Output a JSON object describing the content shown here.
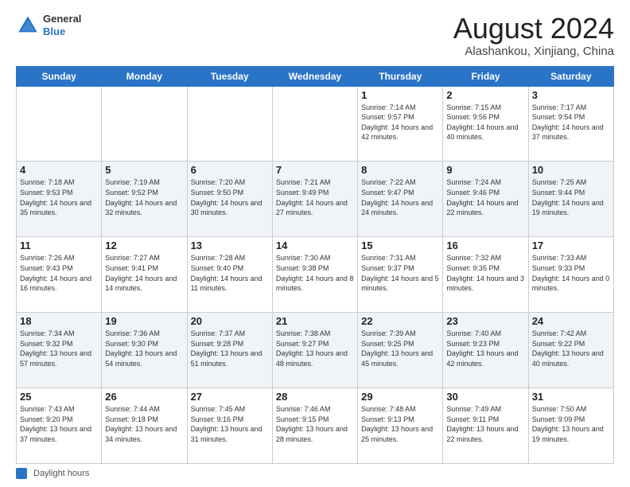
{
  "header": {
    "logo": {
      "general": "General",
      "blue": "Blue"
    },
    "title": "August 2024",
    "location": "Alashankou, Xinjiang, China"
  },
  "weekdays": [
    "Sunday",
    "Monday",
    "Tuesday",
    "Wednesday",
    "Thursday",
    "Friday",
    "Saturday"
  ],
  "weeks": [
    [
      {
        "day": "",
        "info": ""
      },
      {
        "day": "",
        "info": ""
      },
      {
        "day": "",
        "info": ""
      },
      {
        "day": "",
        "info": ""
      },
      {
        "day": "1",
        "info": "Sunrise: 7:14 AM\nSunset: 9:57 PM\nDaylight: 14 hours and 42 minutes."
      },
      {
        "day": "2",
        "info": "Sunrise: 7:15 AM\nSunset: 9:56 PM\nDaylight: 14 hours and 40 minutes."
      },
      {
        "day": "3",
        "info": "Sunrise: 7:17 AM\nSunset: 9:54 PM\nDaylight: 14 hours and 37 minutes."
      }
    ],
    [
      {
        "day": "4",
        "info": "Sunrise: 7:18 AM\nSunset: 9:53 PM\nDaylight: 14 hours and 35 minutes."
      },
      {
        "day": "5",
        "info": "Sunrise: 7:19 AM\nSunset: 9:52 PM\nDaylight: 14 hours and 32 minutes."
      },
      {
        "day": "6",
        "info": "Sunrise: 7:20 AM\nSunset: 9:50 PM\nDaylight: 14 hours and 30 minutes."
      },
      {
        "day": "7",
        "info": "Sunrise: 7:21 AM\nSunset: 9:49 PM\nDaylight: 14 hours and 27 minutes."
      },
      {
        "day": "8",
        "info": "Sunrise: 7:22 AM\nSunset: 9:47 PM\nDaylight: 14 hours and 24 minutes."
      },
      {
        "day": "9",
        "info": "Sunrise: 7:24 AM\nSunset: 9:46 PM\nDaylight: 14 hours and 22 minutes."
      },
      {
        "day": "10",
        "info": "Sunrise: 7:25 AM\nSunset: 9:44 PM\nDaylight: 14 hours and 19 minutes."
      }
    ],
    [
      {
        "day": "11",
        "info": "Sunrise: 7:26 AM\nSunset: 9:43 PM\nDaylight: 14 hours and 16 minutes."
      },
      {
        "day": "12",
        "info": "Sunrise: 7:27 AM\nSunset: 9:41 PM\nDaylight: 14 hours and 14 minutes."
      },
      {
        "day": "13",
        "info": "Sunrise: 7:28 AM\nSunset: 9:40 PM\nDaylight: 14 hours and 11 minutes."
      },
      {
        "day": "14",
        "info": "Sunrise: 7:30 AM\nSunset: 9:38 PM\nDaylight: 14 hours and 8 minutes."
      },
      {
        "day": "15",
        "info": "Sunrise: 7:31 AM\nSunset: 9:37 PM\nDaylight: 14 hours and 5 minutes."
      },
      {
        "day": "16",
        "info": "Sunrise: 7:32 AM\nSunset: 9:35 PM\nDaylight: 14 hours and 3 minutes."
      },
      {
        "day": "17",
        "info": "Sunrise: 7:33 AM\nSunset: 9:33 PM\nDaylight: 14 hours and 0 minutes."
      }
    ],
    [
      {
        "day": "18",
        "info": "Sunrise: 7:34 AM\nSunset: 9:32 PM\nDaylight: 13 hours and 57 minutes."
      },
      {
        "day": "19",
        "info": "Sunrise: 7:36 AM\nSunset: 9:30 PM\nDaylight: 13 hours and 54 minutes."
      },
      {
        "day": "20",
        "info": "Sunrise: 7:37 AM\nSunset: 9:28 PM\nDaylight: 13 hours and 51 minutes."
      },
      {
        "day": "21",
        "info": "Sunrise: 7:38 AM\nSunset: 9:27 PM\nDaylight: 13 hours and 48 minutes."
      },
      {
        "day": "22",
        "info": "Sunrise: 7:39 AM\nSunset: 9:25 PM\nDaylight: 13 hours and 45 minutes."
      },
      {
        "day": "23",
        "info": "Sunrise: 7:40 AM\nSunset: 9:23 PM\nDaylight: 13 hours and 42 minutes."
      },
      {
        "day": "24",
        "info": "Sunrise: 7:42 AM\nSunset: 9:22 PM\nDaylight: 13 hours and 40 minutes."
      }
    ],
    [
      {
        "day": "25",
        "info": "Sunrise: 7:43 AM\nSunset: 9:20 PM\nDaylight: 13 hours and 37 minutes."
      },
      {
        "day": "26",
        "info": "Sunrise: 7:44 AM\nSunset: 9:18 PM\nDaylight: 13 hours and 34 minutes."
      },
      {
        "day": "27",
        "info": "Sunrise: 7:45 AM\nSunset: 9:16 PM\nDaylight: 13 hours and 31 minutes."
      },
      {
        "day": "28",
        "info": "Sunrise: 7:46 AM\nSunset: 9:15 PM\nDaylight: 13 hours and 28 minutes."
      },
      {
        "day": "29",
        "info": "Sunrise: 7:48 AM\nSunset: 9:13 PM\nDaylight: 13 hours and 25 minutes."
      },
      {
        "day": "30",
        "info": "Sunrise: 7:49 AM\nSunset: 9:11 PM\nDaylight: 13 hours and 22 minutes."
      },
      {
        "day": "31",
        "info": "Sunrise: 7:50 AM\nSunset: 9:09 PM\nDaylight: 13 hours and 19 minutes."
      }
    ]
  ],
  "footer": {
    "daylight_label": "Daylight hours"
  }
}
